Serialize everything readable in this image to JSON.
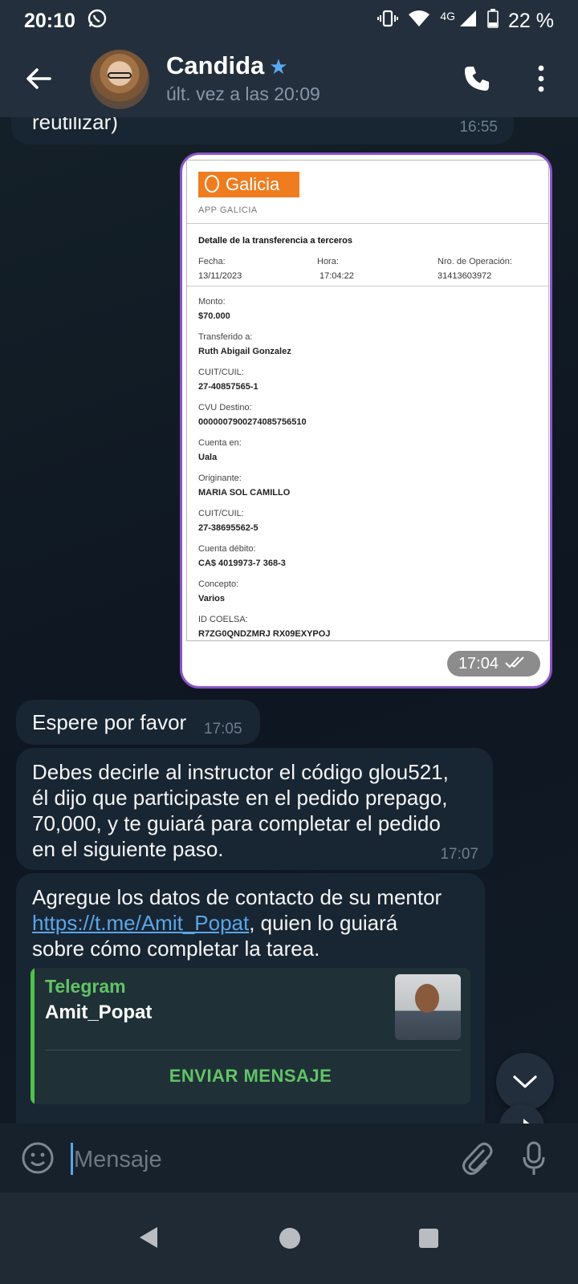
{
  "status_bar": {
    "time": "20:10",
    "network": "4G",
    "battery": "22 %"
  },
  "header": {
    "contact_name": "Candida",
    "last_seen": "últ. vez a las 20:09"
  },
  "messages": {
    "prev_fragment": {
      "text": "reutilizar)",
      "time": "16:55"
    },
    "receipt": {
      "time": "17:04",
      "brand": "Galicia",
      "app_label": "APP GALICIA",
      "title": "Detalle de la transferencia a terceros",
      "fecha_label": "Fecha:",
      "fecha": "13/11/2023",
      "hora_label": "Hora:",
      "hora": "17:04:22",
      "op_label": "Nro. de Operación:",
      "op": "31413603972",
      "fields": [
        {
          "label": "Monto:",
          "value": "$70.000"
        },
        {
          "label": "Transferido a:",
          "value": "Ruth Abigail Gonzalez"
        },
        {
          "label": "CUIT/CUIL:",
          "value": "27-40857565-1"
        },
        {
          "label": "CVU Destino:",
          "value": "0000007900274085756510"
        },
        {
          "label": "Cuenta en:",
          "value": "Uala"
        },
        {
          "label": "Originante:",
          "value": "MARIA SOL CAMILLO"
        },
        {
          "label": "CUIT/CUIL:",
          "value": "27-38695562-5"
        },
        {
          "label": "Cuenta débito:",
          "value": "CA$ 4019973-7 368-3"
        },
        {
          "label": "Concepto:",
          "value": "Varios"
        },
        {
          "label": "ID COELSA:",
          "value": "R7ZG0QNDZMRJ RX09EXYPOJ"
        }
      ]
    },
    "wait": {
      "text": "Espere por favor",
      "time": "17:05"
    },
    "instructor": {
      "lines": [
        "Debes decirle al instructor el código glou521,",
        "él dijo que participaste en el pedido prepago,",
        "70,000, y te guiará para completar el pedido",
        "en el siguiente paso."
      ],
      "time": "17:07"
    },
    "mentor": {
      "line1": "Agregue los datos de contacto de su mentor",
      "link": "https://t.me/Amit_Popat",
      "line2_rest": ", quien lo guiará",
      "line3": "sobre cómo completar la tarea.",
      "preview": {
        "site": "Telegram",
        "title": "Amit_Popat",
        "button": "ENVIAR MENSAJE"
      }
    }
  },
  "input": {
    "placeholder": "Mensaje"
  },
  "colors": {
    "accent": "#5ba6e8",
    "receipt_border": "#8a54c8",
    "galicia_orange": "#ef7d1f",
    "preview_green": "#62c367"
  }
}
